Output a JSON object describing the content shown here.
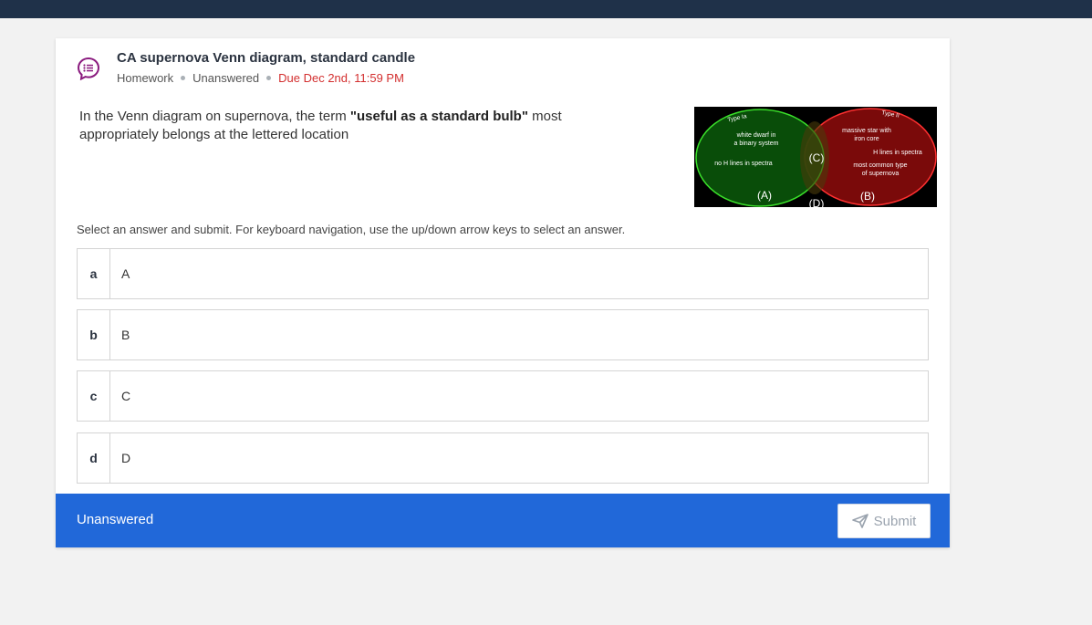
{
  "question": {
    "title": "CA supernova Venn diagram, standard candle",
    "meta": {
      "type": "Homework",
      "status": "Unanswered",
      "due": "Due Dec 2nd, 11:59 PM"
    },
    "prompt_before": "In the Venn diagram on supernova, the term ",
    "prompt_emphasis": "\"useful as a standard bulb\"",
    "prompt_after": " most appropriately belongs at the lettered location",
    "instructions": "Select an answer and submit. For keyboard navigation, use the up/down arrow keys to select an answer."
  },
  "venn": {
    "left_label": "Type Ia",
    "right_label": "Type II",
    "left_text_1": "white dwarf in",
    "left_text_2": "a binary system",
    "left_text_3": "no H lines in spectra",
    "right_text_1": "massive star with",
    "right_text_2": "iron core",
    "right_text_3": "H lines in spectra",
    "right_text_4": "most common type",
    "right_text_5": "of supernova",
    "marker_a": "(A)",
    "marker_b": "(B)",
    "marker_c": "(C)",
    "marker_d": "(D)",
    "colors": {
      "left": "#0a5a0a",
      "right": "#7a0a0a",
      "left_stroke": "#3adf2a",
      "right_stroke": "#ff3030"
    }
  },
  "choices": [
    {
      "letter": "a",
      "text": "A"
    },
    {
      "letter": "b",
      "text": "B"
    },
    {
      "letter": "c",
      "text": "C"
    },
    {
      "letter": "d",
      "text": "D"
    }
  ],
  "footer": {
    "status": "Unanswered",
    "submit_label": "Submit"
  },
  "icons": {
    "question": "question-bubble-icon",
    "submit": "paper-plane-icon"
  }
}
